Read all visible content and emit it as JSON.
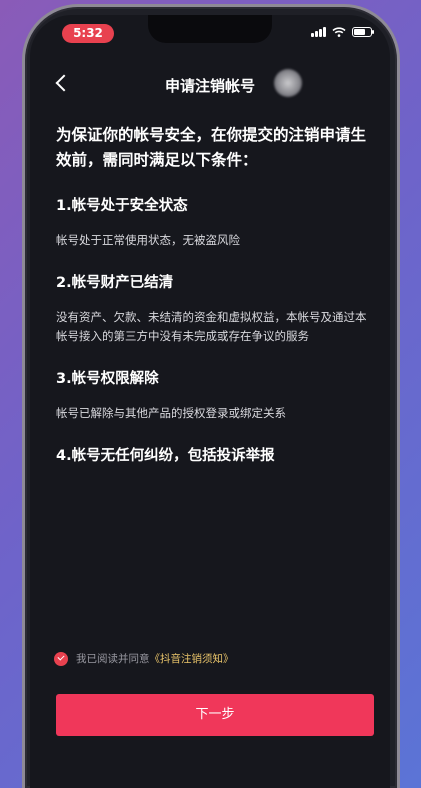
{
  "status_bar": {
    "time": "5:32"
  },
  "header": {
    "title": "申请注销帐号"
  },
  "intro": "为保证你的帐号安全，在你提交的注销申请生效前，需同时满足以下条件：",
  "sections": [
    {
      "title": "1.帐号处于安全状态",
      "desc": "帐号处于正常使用状态，无被盗风险"
    },
    {
      "title": "2.帐号财产已结清",
      "desc": "没有资产、欠款、未结清的资金和虚拟权益，本帐号及通过本帐号接入的第三方中没有未完成或存在争议的服务"
    },
    {
      "title": "3.帐号权限解除",
      "desc": "帐号已解除与其他产品的授权登录或绑定关系"
    },
    {
      "title": "4.帐号无任何纠纷，包括投诉举报",
      "desc": ""
    }
  ],
  "agreement": {
    "checked": true,
    "prefix": "我已阅读并同意",
    "link": "《抖音注销须知》"
  },
  "next_button": {
    "label": "下一步"
  },
  "colors": {
    "accent": "#f0375a",
    "background": "#16171d",
    "link": "#e9c46a"
  }
}
